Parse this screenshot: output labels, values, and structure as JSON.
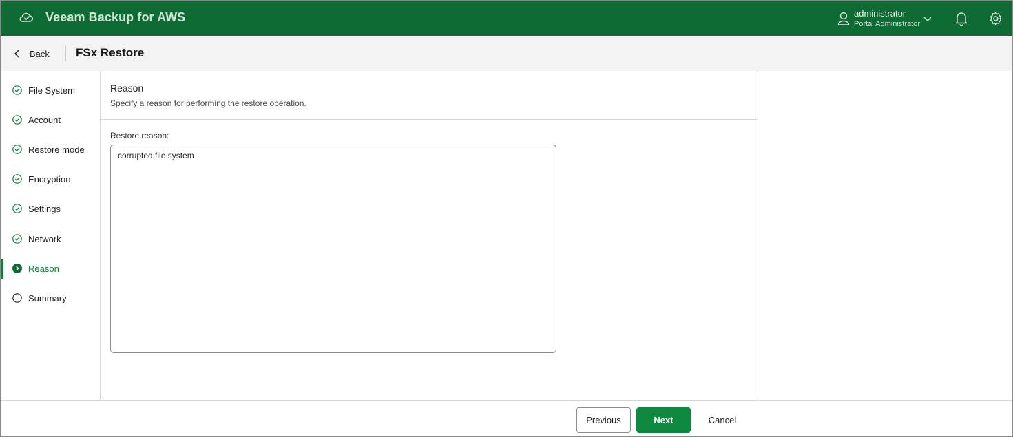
{
  "app": {
    "title": "Veeam Backup for AWS",
    "logo_icon": "cloud-sync-icon"
  },
  "user": {
    "name": "administrator",
    "role": "Portal Administrator"
  },
  "header": {
    "back_label": "Back",
    "page_title": "FSx Restore"
  },
  "steps": [
    {
      "label": "File System",
      "state": "done"
    },
    {
      "label": "Account",
      "state": "done"
    },
    {
      "label": "Restore mode",
      "state": "done"
    },
    {
      "label": "Encryption",
      "state": "done"
    },
    {
      "label": "Settings",
      "state": "done"
    },
    {
      "label": "Network",
      "state": "done"
    },
    {
      "label": "Reason",
      "state": "active"
    },
    {
      "label": "Summary",
      "state": "pending"
    }
  ],
  "section": {
    "title": "Reason",
    "description": "Specify a reason for performing the restore operation.",
    "field_label": "Restore reason:",
    "field_value": "corrupted file system"
  },
  "footer": {
    "previous_label": "Previous",
    "next_label": "Next",
    "cancel_label": "Cancel"
  },
  "colors": {
    "brand_green": "#0e6b34",
    "accent_green": "#0e7a3b",
    "button_green": "#0d8a3f"
  }
}
